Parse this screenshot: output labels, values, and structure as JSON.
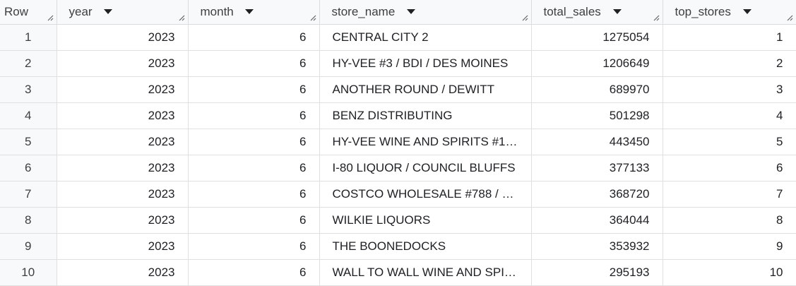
{
  "columns": {
    "row": "Row",
    "year": "year",
    "month": "month",
    "store_name": "store_name",
    "total_sales": "total_sales",
    "top_stores": "top_stores"
  },
  "rows": [
    {
      "row": "1",
      "year": "2023",
      "month": "6",
      "store_name": "CENTRAL CITY 2",
      "total_sales": "1275054",
      "top_stores": "1"
    },
    {
      "row": "2",
      "year": "2023",
      "month": "6",
      "store_name": "HY-VEE #3 / BDI / DES MOINES",
      "total_sales": "1206649",
      "top_stores": "2"
    },
    {
      "row": "3",
      "year": "2023",
      "month": "6",
      "store_name": "ANOTHER ROUND / DEWITT",
      "total_sales": "689970",
      "top_stores": "3"
    },
    {
      "row": "4",
      "year": "2023",
      "month": "6",
      "store_name": "BENZ DISTRIBUTING",
      "total_sales": "501298",
      "top_stores": "4"
    },
    {
      "row": "5",
      "year": "2023",
      "month": "6",
      "store_name": "HY-VEE WINE AND SPIRITS #1 …",
      "total_sales": "443450",
      "top_stores": "5"
    },
    {
      "row": "6",
      "year": "2023",
      "month": "6",
      "store_name": "I-80 LIQUOR / COUNCIL BLUFFS",
      "total_sales": "377133",
      "top_stores": "6"
    },
    {
      "row": "7",
      "year": "2023",
      "month": "6",
      "store_name": "COSTCO WHOLESALE #788 / …",
      "total_sales": "368720",
      "top_stores": "7"
    },
    {
      "row": "8",
      "year": "2023",
      "month": "6",
      "store_name": "WILKIE LIQUORS",
      "total_sales": "364044",
      "top_stores": "8"
    },
    {
      "row": "9",
      "year": "2023",
      "month": "6",
      "store_name": "THE BOONEDOCKS",
      "total_sales": "353932",
      "top_stores": "9"
    },
    {
      "row": "10",
      "year": "2023",
      "month": "6",
      "store_name": "WALL TO WALL WINE AND SPI…",
      "total_sales": "295193",
      "top_stores": "10"
    }
  ],
  "icons": {
    "sort": "caret-down-icon",
    "resize": "resize-grip-icon"
  }
}
